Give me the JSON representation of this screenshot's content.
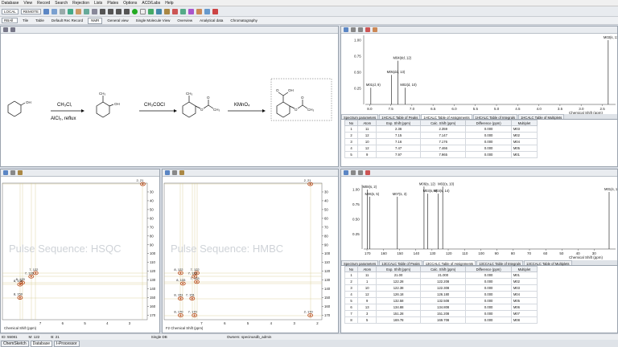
{
  "menu": [
    "Database",
    "View",
    "Record",
    "Search",
    "Rejection",
    "Lists",
    "Plates",
    "Options",
    "ACD/Labs",
    "Help"
  ],
  "toolbar": {
    "local": "LOCAL",
    "remote": "REMOTE"
  },
  "nav": {
    "tile": "Tile",
    "table": "Table",
    "default_record": "Default Rec Record",
    "nmr": "NMR",
    "general": "General view",
    "single_molecule": "Single Molecule View",
    "overview": "Overview",
    "analytical": "Analytical data",
    "chromatography": "Chromatography",
    "filter": "RBAll"
  },
  "scheme": {
    "reagent1": "CH₃Cl,",
    "reagent1b": "AlCl₃, reflux",
    "reagent2": "CH₃COCl",
    "reagent3": "KMnO₄",
    "oh1": "OH",
    "oh2": "OH",
    "oh3": "OH",
    "ch3a": "CH₃",
    "ch3b": "CH₃",
    "ch3c": "CH₃",
    "ch3d": "CH₃",
    "o1": "O",
    "o2": "O",
    "o3": "O",
    "o4": "O",
    "o5": "O"
  },
  "h1": {
    "xlabel": "Chemical Shift (ppm)",
    "ticks": [
      "8.0",
      "7.5",
      "7.0",
      "6.5",
      "6.0",
      "5.5",
      "5.0",
      "4.5",
      "4.0",
      "3.5",
      "3.0",
      "2.5"
    ],
    "yticks": [
      "1.00",
      "0.75",
      "0.50",
      "0.25"
    ],
    "peaks": [
      {
        "label": "M01(d, 9)",
        "ppm": 7.97,
        "h": 0.26
      },
      {
        "label": "M05(dd, 13)",
        "ppm": 7.48,
        "h": 0.46
      },
      {
        "label": "M04(dd, 12)",
        "ppm": 7.33,
        "h": 0.68
      },
      {
        "label": "M02(d, 10)",
        "ppm": 7.16,
        "h": 0.26
      },
      {
        "label": "M03(s, 11)",
        "ppm": 2.36,
        "h": 1.0
      }
    ],
    "tabs": [
      "Spectrum parameters",
      "1HCALC Table of Peaks",
      "1HCALC Table of Assignments",
      "1HCALC Table of Integrals",
      "1HCALC Table of Multiplets"
    ],
    "headers": [
      "No",
      "Atom",
      "Exp. Shift (ppm)",
      "Calc. Shift (ppm)",
      "Difference (ppm)",
      "Multiplet"
    ],
    "rows": [
      [
        "1",
        "11",
        "2.36",
        "2.359",
        "0.000",
        "M03"
      ],
      [
        "2",
        "12",
        "7.15",
        "7.147",
        "0.000",
        "M02"
      ],
      [
        "3",
        "10",
        "7.16",
        "7.176",
        "0.000",
        "M04"
      ],
      [
        "4",
        "12",
        "7.47",
        "7.466",
        "0.000",
        "M05"
      ],
      [
        "5",
        "9",
        "7.97",
        "7.965",
        "0.000",
        "M01"
      ]
    ]
  },
  "c13": {
    "xlabel": "Chemical Shift (ppm)",
    "ticks": [
      "170",
      "160",
      "150",
      "140",
      "130",
      "120",
      "110",
      "100",
      "90",
      "80",
      "70",
      "60",
      "50",
      "40",
      "30"
    ],
    "yticks": [
      "1.00",
      "0.75",
      "0.50",
      "0.25"
    ],
    "peaks": [
      {
        "label": "M08(s, 2)",
        "ppm": 169.8,
        "h": 1.0
      },
      {
        "label": "M06(s, 5)",
        "ppm": 168.3,
        "h": 0.88
      },
      {
        "label": "M07(s, 3)",
        "ppm": 151.3,
        "h": 0.88
      },
      {
        "label": "M06(s, 12)",
        "ppm": 134.9,
        "h": 1.1
      },
      {
        "label": "M03(s, 8)",
        "ppm": 132.6,
        "h": 0.93
      },
      {
        "label": "M03(s, 14)",
        "ppm": 126.2,
        "h": 0.93
      },
      {
        "label": "M02(s, 10)",
        "ppm": 123.4,
        "h": 1.1
      },
      {
        "label": "M01(s, 11)",
        "ppm": 21.0,
        "h": 0.96
      }
    ],
    "tabs": [
      "Spectrum parameters",
      "13CCALC Table of Peaks",
      "13CCALC Table of Assignments",
      "13CCALC Table of Integrals",
      "13CCALC Table of Multiplets"
    ],
    "headers": [
      "No",
      "Atom",
      "Exp. Shift (ppm)",
      "Calc. Shift (ppm)",
      "Difference (ppm)",
      "Multiplet"
    ],
    "rows": [
      [
        "1",
        "11",
        "21.00",
        "21.000",
        "0.000",
        "M01"
      ],
      [
        "2",
        "1",
        "122.28",
        "122.208",
        "0.000",
        "M02"
      ],
      [
        "3",
        "10",
        "122.38",
        "122.308",
        "0.000",
        "M03"
      ],
      [
        "4",
        "12",
        "126.18",
        "126.180",
        "0.000",
        "M04"
      ],
      [
        "5",
        "9",
        "132.58",
        "132.508",
        "0.000",
        "M05"
      ],
      [
        "6",
        "13",
        "134.88",
        "134.808",
        "0.000",
        "M06"
      ],
      [
        "7",
        "3",
        "151.28",
        "151.208",
        "0.000",
        "M07"
      ],
      [
        "8",
        "5",
        "169.78",
        "169.708",
        "0.000",
        "M08"
      ]
    ]
  },
  "hsqc": {
    "watermark": "Pulse Sequence: HSQC",
    "xlabel": "Chemical Shift (ppm)",
    "ticks": [
      "7",
      "6",
      "5",
      "4",
      "3"
    ],
    "yticks": [
      "30",
      "40",
      "50",
      "60",
      "70",
      "80",
      "90",
      "100",
      "110",
      "120",
      "130",
      "140",
      "150",
      "160",
      "170"
    ],
    "cross": [
      {
        "label": "2, 21",
        "x": 2.4,
        "y": 21
      },
      {
        "label": "7, 122",
        "x": 7.2,
        "y": 122
      },
      {
        "label": "7, 126",
        "x": 7.4,
        "y": 126
      },
      {
        "label": "8, 133",
        "x": 7.8,
        "y": 133
      },
      {
        "label": "8, 135",
        "x": 7.9,
        "y": 135
      },
      {
        "label": "8, 150",
        "x": 7.9,
        "y": 150
      }
    ]
  },
  "hmbc": {
    "watermark": "Pulse Sequence: HMBC",
    "xlabel": "F2 Chemical Shift (ppm)",
    "ticks": [
      "7",
      "6",
      "5",
      "4",
      "3",
      "2"
    ],
    "yticks": [
      "30",
      "40",
      "50",
      "60",
      "70",
      "80",
      "90",
      "100",
      "110",
      "120",
      "130",
      "140",
      "150",
      "160",
      "170"
    ],
    "cross": [
      {
        "label": "2, 21",
        "x": 2.3,
        "y": 21
      },
      {
        "label": "8, 122",
        "x": 7.9,
        "y": 122
      },
      {
        "label": "7, 122",
        "x": 7.2,
        "y": 122
      },
      {
        "label": "7, 126",
        "x": 7.3,
        "y": 126
      },
      {
        "label": "7, 133",
        "x": 7.2,
        "y": 132
      },
      {
        "label": "8, 133",
        "x": 7.8,
        "y": 134
      },
      {
        "label": "8, 151",
        "x": 7.9,
        "y": 151
      },
      {
        "label": "7, 151",
        "x": 7.4,
        "y": 151
      },
      {
        "label": "8, 170",
        "x": 7.9,
        "y": 170
      },
      {
        "label": "7, 170",
        "x": 7.3,
        "y": 170
      },
      {
        "label": "2, 170",
        "x": 2.3,
        "y": 170
      }
    ]
  },
  "status": {
    "id": "ID: 55081",
    "m": "M: 122",
    "b": "B: 21",
    "mode": "Single DB",
    "owners": "Owners: specinusdb_admin"
  },
  "bottom_tabs": [
    "ChemSketch",
    "Database",
    "I-Processor"
  ],
  "colors": {
    "accent": "#2a5da8",
    "cross": "#b84a1a",
    "peak": "#1a1a1a"
  }
}
